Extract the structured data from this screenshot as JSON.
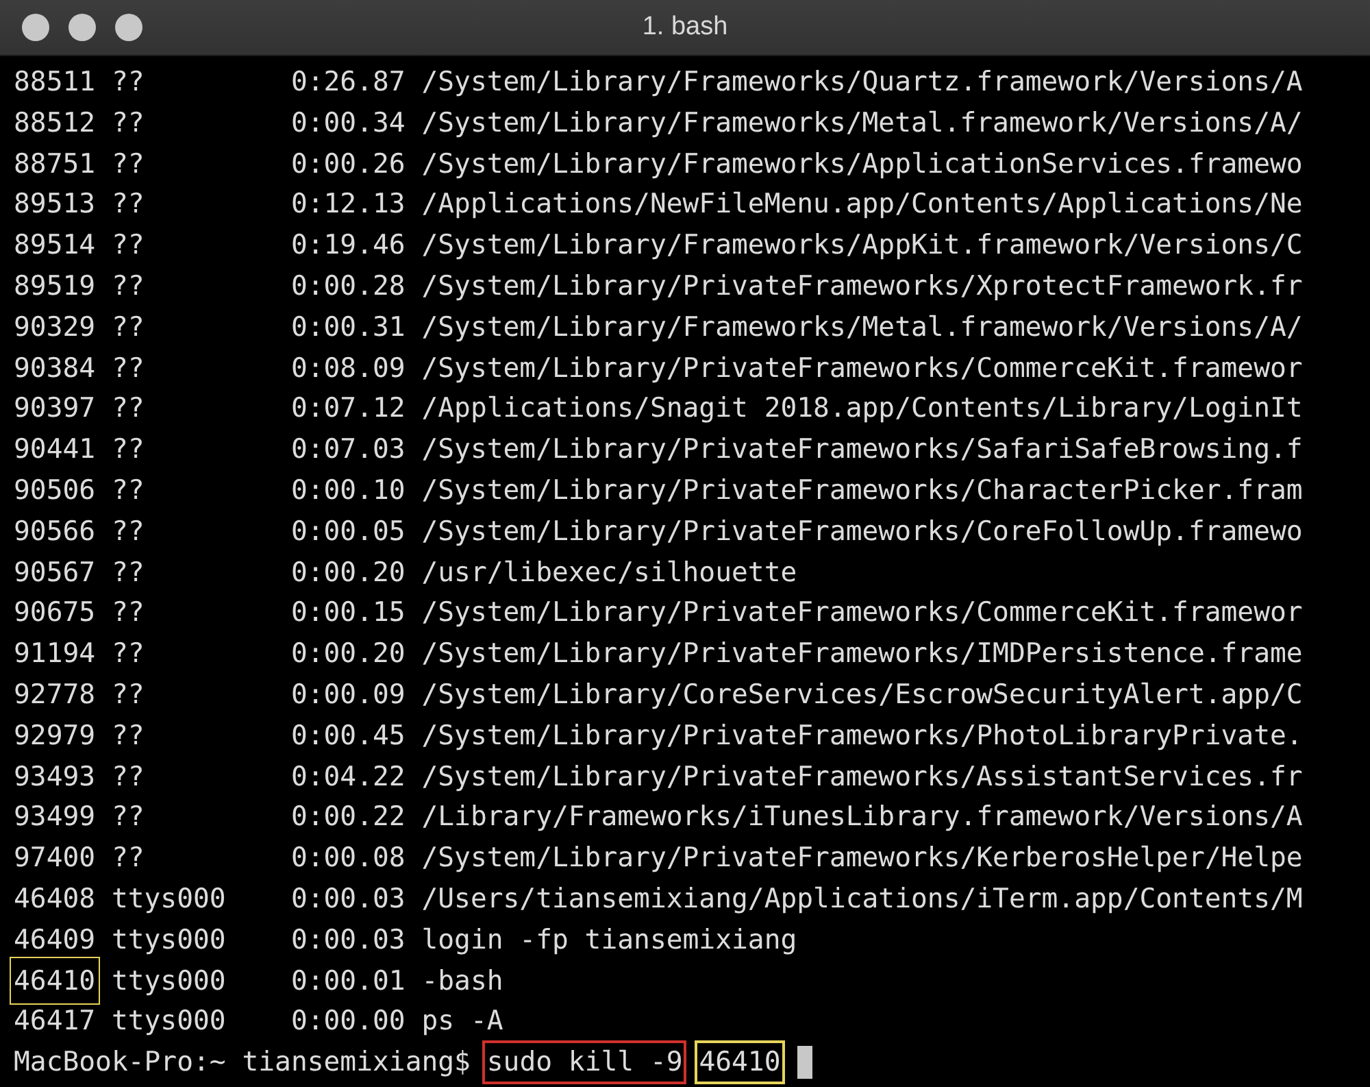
{
  "window": {
    "title": "1. bash"
  },
  "rows": [
    {
      "pid": "88511",
      "tty": "??",
      "time": "0:26.87",
      "command": "/System/Library/Frameworks/Quartz.framework/Versions/A",
      "highlighted": false
    },
    {
      "pid": "88512",
      "tty": "??",
      "time": "0:00.34",
      "command": "/System/Library/Frameworks/Metal.framework/Versions/A/",
      "highlighted": false
    },
    {
      "pid": "88751",
      "tty": "??",
      "time": "0:00.26",
      "command": "/System/Library/Frameworks/ApplicationServices.framewo",
      "highlighted": false
    },
    {
      "pid": "89513",
      "tty": "??",
      "time": "0:12.13",
      "command": "/Applications/NewFileMenu.app/Contents/Applications/Ne",
      "highlighted": false
    },
    {
      "pid": "89514",
      "tty": "??",
      "time": "0:19.46",
      "command": "/System/Library/Frameworks/AppKit.framework/Versions/C",
      "highlighted": false
    },
    {
      "pid": "89519",
      "tty": "??",
      "time": "0:00.28",
      "command": "/System/Library/PrivateFrameworks/XprotectFramework.fr",
      "highlighted": false
    },
    {
      "pid": "90329",
      "tty": "??",
      "time": "0:00.31",
      "command": "/System/Library/Frameworks/Metal.framework/Versions/A/",
      "highlighted": false
    },
    {
      "pid": "90384",
      "tty": "??",
      "time": "0:08.09",
      "command": "/System/Library/PrivateFrameworks/CommerceKit.framewor",
      "highlighted": false
    },
    {
      "pid": "90397",
      "tty": "??",
      "time": "0:07.12",
      "command": "/Applications/Snagit 2018.app/Contents/Library/LoginIt",
      "highlighted": false
    },
    {
      "pid": "90441",
      "tty": "??",
      "time": "0:07.03",
      "command": "/System/Library/PrivateFrameworks/SafariSafeBrowsing.f",
      "highlighted": false
    },
    {
      "pid": "90506",
      "tty": "??",
      "time": "0:00.10",
      "command": "/System/Library/PrivateFrameworks/CharacterPicker.fram",
      "highlighted": false
    },
    {
      "pid": "90566",
      "tty": "??",
      "time": "0:00.05",
      "command": "/System/Library/PrivateFrameworks/CoreFollowUp.framewo",
      "highlighted": false
    },
    {
      "pid": "90567",
      "tty": "??",
      "time": "0:00.20",
      "command": "/usr/libexec/silhouette",
      "highlighted": false
    },
    {
      "pid": "90675",
      "tty": "??",
      "time": "0:00.15",
      "command": "/System/Library/PrivateFrameworks/CommerceKit.framewor",
      "highlighted": false
    },
    {
      "pid": "91194",
      "tty": "??",
      "time": "0:00.20",
      "command": "/System/Library/PrivateFrameworks/IMDPersistence.frame",
      "highlighted": false
    },
    {
      "pid": "92778",
      "tty": "??",
      "time": "0:00.09",
      "command": "/System/Library/CoreServices/EscrowSecurityAlert.app/C",
      "highlighted": false
    },
    {
      "pid": "92979",
      "tty": "??",
      "time": "0:00.45",
      "command": "/System/Library/PrivateFrameworks/PhotoLibraryPrivate.",
      "highlighted": false
    },
    {
      "pid": "93493",
      "tty": "??",
      "time": "0:04.22",
      "command": "/System/Library/PrivateFrameworks/AssistantServices.fr",
      "highlighted": false
    },
    {
      "pid": "93499",
      "tty": "??",
      "time": "0:00.22",
      "command": "/Library/Frameworks/iTunesLibrary.framework/Versions/A",
      "highlighted": false
    },
    {
      "pid": "97400",
      "tty": "??",
      "time": "0:00.08",
      "command": "/System/Library/PrivateFrameworks/KerberosHelper/Helpe",
      "highlighted": false
    },
    {
      "pid": "46408",
      "tty": "ttys000",
      "time": "0:00.03",
      "command": "/Users/tiansemixiang/Applications/iTerm.app/Contents/M",
      "highlighted": false
    },
    {
      "pid": "46409",
      "tty": "ttys000",
      "time": "0:00.03",
      "command": "login -fp tiansemixiang",
      "highlighted": false
    },
    {
      "pid": "46410",
      "tty": "ttys000",
      "time": "0:00.01",
      "command": "-bash",
      "highlighted": true
    },
    {
      "pid": "46417",
      "tty": "ttys000",
      "time": "0:00.00",
      "command": "ps -A",
      "highlighted": false
    }
  ],
  "prompt": {
    "text": "MacBook-Pro:~ tiansemixiang$",
    "command_parts": [
      {
        "text": "sudo kill -9",
        "color": "#d0312d"
      },
      {
        "text": "46410",
        "color": "#e6d35a"
      }
    ],
    "cursor": true
  }
}
